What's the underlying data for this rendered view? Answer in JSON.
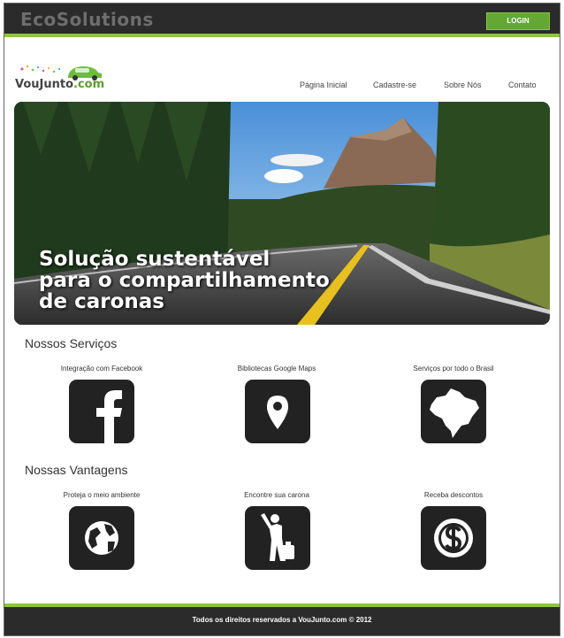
{
  "header": {
    "brand": "EcoSolutions",
    "login_label": "LOGIN"
  },
  "logo": {
    "text_a": "VouJunto",
    "text_b": ".com"
  },
  "nav": {
    "items": [
      {
        "label": "Página Inicial"
      },
      {
        "label": "Cadastre-se"
      },
      {
        "label": "Sobre Nós"
      },
      {
        "label": "Contato"
      }
    ]
  },
  "hero": {
    "line1": "Solução sustentável",
    "line2": "para o compartilhamento",
    "line3": "de caronas"
  },
  "services": {
    "title": "Nossos Serviços",
    "items": [
      {
        "label": "Integração com Facebook",
        "icon": "facebook-icon"
      },
      {
        "label": "Bibliotecas Google Maps",
        "icon": "map-pin-icon"
      },
      {
        "label": "Serviços por todo o Brasil",
        "icon": "brazil-map-icon"
      }
    ]
  },
  "advantages": {
    "title": "Nossas Vantagens",
    "items": [
      {
        "label": "Proteja o meio ambiente",
        "icon": "globe-icon"
      },
      {
        "label": "Encontre sua carona",
        "icon": "hitchhiker-icon"
      },
      {
        "label": "Receba descontos",
        "icon": "dollar-icon"
      }
    ]
  },
  "footer": {
    "text": "Todos os direitos reservados a VouJunto.com © 2012"
  },
  "colors": {
    "accent": "#8dc63f",
    "dark": "#2b2b2b",
    "login": "#62a832"
  }
}
